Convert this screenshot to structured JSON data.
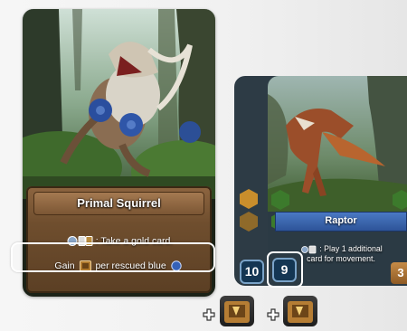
{
  "squirrel_card": {
    "title": "Primal Squirrel",
    "ability_text": ": Take a gold card.",
    "bonus_prefix": "Gain",
    "bonus_suffix": "per rescued blue",
    "colors": {
      "panel": "#6f4e2e",
      "title_bar": "#8d6540"
    }
  },
  "raptor_card": {
    "title": "Raptor",
    "ability_line1": ": Play 1 additional",
    "ability_line2": "card for movement.",
    "cost": "3",
    "colors": {
      "title_bar": "#2c5296",
      "hex_green": "#3c7a2c",
      "hex_gold": "#c98e2c"
    }
  },
  "stats": {
    "left_value": "10",
    "right_value": "9"
  },
  "icons": [
    "squirrel-art",
    "raptor-art",
    "gold-card-icon",
    "blue-token-icon",
    "plus-icon",
    "reward-token-icon"
  ],
  "highlight_color": "#ffffff"
}
